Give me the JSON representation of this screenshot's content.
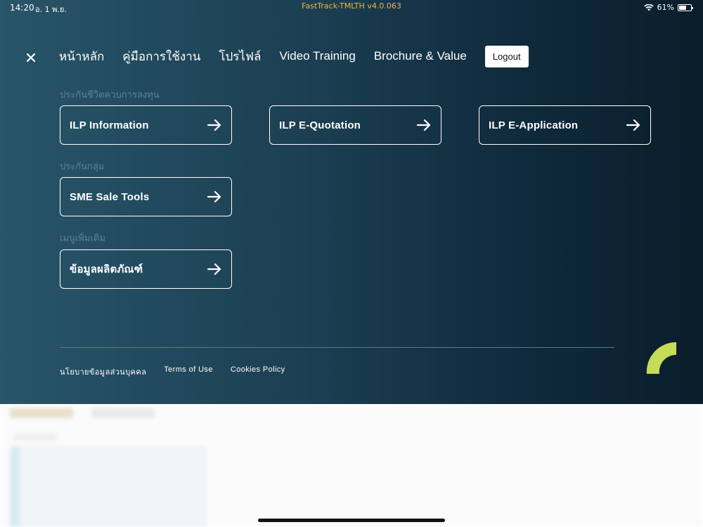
{
  "status_bar": {
    "time": "14:20",
    "date": "อ. 1 พ.ย.",
    "app_version": "FastTrack-TMLTH v4.0.063",
    "battery": "61%",
    "battery_level": 0.61
  },
  "nav": {
    "close_icon": "close-icon",
    "items": [
      "หน้าหลัก",
      "คู่มือการใช้งาน",
      "โปรไฟล์",
      "Video Training",
      "Brochure & Value"
    ],
    "logout_label": "Logout"
  },
  "sections": [
    {
      "title": "ประกันชีวิตควบการลงทุน",
      "items": [
        "ILP Information",
        "ILP E-Quotation",
        "ILP E-Application"
      ]
    },
    {
      "title": "ประกันกลุ่ม",
      "items": [
        "SME Sale Tools"
      ]
    },
    {
      "title": "เมนูเพิ่มเติม",
      "items": [
        "ข้อมูลผลิตภัณฑ์"
      ]
    }
  ],
  "footer": {
    "links": [
      "นโยบายข้อมูลส่วนบุคคล",
      "Terms of Use",
      "Cookies Policy"
    ]
  },
  "colors": {
    "accent": "#c7dc56",
    "status_app": "#f0b63b",
    "section_label": "#5d8296"
  }
}
